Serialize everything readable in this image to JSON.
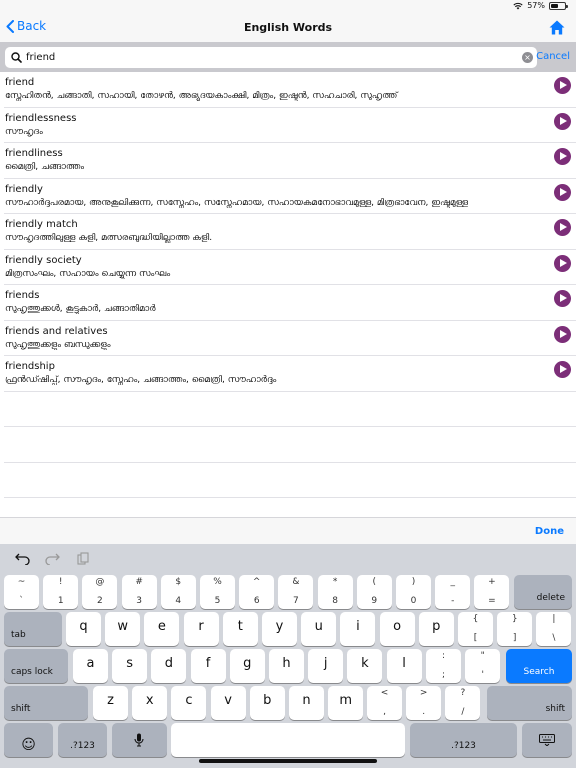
{
  "status": {
    "battery": "57%",
    "battery_level": 0.57
  },
  "nav": {
    "back_label": "Back",
    "title": "English Words"
  },
  "search": {
    "value": "friend",
    "cancel_label": "Cancel"
  },
  "results": [
    {
      "word": "friend",
      "meaning": "സ്നേഹിതൻ, ചങ്ങാതി, സഹായി, തോഴൻ, അഭ്യുദയകാംക്ഷി, മിത്രം, ഇഷ്ടൻ, സഹചാരി, സുഹൃത്ത്"
    },
    {
      "word": "friendlessness",
      "meaning": "സൗഹൃദം"
    },
    {
      "word": "friendliness",
      "meaning": "മൈത്രി, ചങ്ങാത്തം"
    },
    {
      "word": "friendly",
      "meaning": "സൗഹാർദ്ദപരമായ, അനുകൂലിക്കുന്ന, സസ്നേഹം, സസ്നേഹമായ, സഹായകമനോഭാവമുള്ള, മിത്രഭാവേന, ഇഷ്ടമുള്ള"
    },
    {
      "word": "friendly match",
      "meaning": "സൗഹൃദത്തിലുള്ള കളി, മത്സരബുദ്ധിയില്ലാത്ത കളി."
    },
    {
      "word": "friendly society",
      "meaning": "മിത്രസംഘം, സഹായം ചെയ്യുന്ന സംഘം"
    },
    {
      "word": "friends",
      "meaning": "സുഹൃത്തുക്കൾ, കൂട്ടുകാർ, ചങ്ങാതിമാർ"
    },
    {
      "word": "friends and relatives",
      "meaning": "സുഹൃത്തുക്കളും ബന്ധുക്കളും"
    },
    {
      "word": "friendship",
      "meaning": "ഫ്രൻഡ്ഷിപ്പ്, സൗഹൃദം, സ്നേഹം, ചങ്ങാത്തം, മൈത്രി, സൗഹാർദ്ദം"
    }
  ],
  "done_label": "Done",
  "keyboard": {
    "row1": [
      {
        "top": "~",
        "bot": "`"
      },
      {
        "top": "!",
        "bot": "1"
      },
      {
        "top": "@",
        "bot": "2"
      },
      {
        "top": "#",
        "bot": "3"
      },
      {
        "top": "$",
        "bot": "4"
      },
      {
        "top": "%",
        "bot": "5"
      },
      {
        "top": "^",
        "bot": "6"
      },
      {
        "top": "&",
        "bot": "7"
      },
      {
        "top": "*",
        "bot": "8"
      },
      {
        "top": "(",
        "bot": "9"
      },
      {
        "top": ")",
        "bot": "0"
      },
      {
        "top": "_",
        "bot": "-"
      },
      {
        "top": "+",
        "bot": "="
      }
    ],
    "delete": "delete",
    "tab": "tab",
    "row2": [
      "q",
      "w",
      "e",
      "r",
      "t",
      "y",
      "u",
      "i",
      "o",
      "p"
    ],
    "row2_extra": [
      {
        "top": "{",
        "bot": "["
      },
      {
        "top": "}",
        "bot": "]"
      },
      {
        "top": "|",
        "bot": "\\"
      }
    ],
    "caps": "caps lock",
    "row3": [
      "a",
      "s",
      "d",
      "f",
      "g",
      "h",
      "j",
      "k",
      "l"
    ],
    "row3_extra": [
      {
        "top": ":",
        "bot": ";"
      },
      {
        "top": "\"",
        "bot": "'"
      }
    ],
    "search": "Search",
    "shift": "shift",
    "row4": [
      "z",
      "x",
      "c",
      "v",
      "b",
      "n",
      "m"
    ],
    "row4_extra": [
      {
        "top": "<",
        "bot": ","
      },
      {
        "top": ">",
        "bot": "."
      },
      {
        "top": "?",
        "bot": "/"
      }
    ],
    "num": ".?123"
  },
  "colors": {
    "accent": "#0a7aff",
    "play": "#7c2e78",
    "keyboard_bg": "#d2d5db"
  }
}
